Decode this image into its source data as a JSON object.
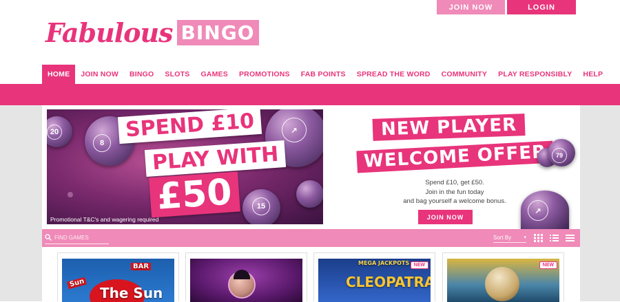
{
  "header": {
    "join_label": "JOIN NOW",
    "login_label": "LOGIN",
    "logo_script": "Fabulous",
    "logo_bingo": "BINGO"
  },
  "nav": {
    "items": [
      {
        "label": "HOME",
        "active": true
      },
      {
        "label": "JOIN NOW"
      },
      {
        "label": "BINGO"
      },
      {
        "label": "SLOTS"
      },
      {
        "label": "GAMES"
      },
      {
        "label": "PROMOTIONS"
      },
      {
        "label": "FAB POINTS"
      },
      {
        "label": "SPREAD THE WORD"
      },
      {
        "label": "COMMUNITY"
      },
      {
        "label": "PLAY RESPONSIBLY"
      },
      {
        "label": "HELP"
      }
    ]
  },
  "hero": {
    "line1": "SPEND £10",
    "line2": "PLAY WITH",
    "line3": "£50",
    "terms": "Promotional T&C's and wagering required",
    "ball_numbers": [
      "20",
      "8",
      "15",
      "79"
    ],
    "offer_title_1": "NEW PLAYER",
    "offer_title_2": "WELCOME OFFER",
    "offer_line1": "Spend £10, get £50.",
    "offer_line2": "Join in the fun today",
    "offer_line3": "and bag yourself a welcome bonus.",
    "offer_button": "JOIN NOW"
  },
  "filters": {
    "search_placeholder": "FIND GAMES",
    "sort_label": "Sort By"
  },
  "games": [
    {
      "title": "The Sun",
      "extra1": "BAR",
      "extra2": "Sun",
      "new": false
    },
    {
      "title": "",
      "new": false
    },
    {
      "title": "MEGA JACKPOTS",
      "subtitle": "CLEOPATRA",
      "new": true,
      "new_label": "NEW"
    },
    {
      "title": "",
      "new": true,
      "new_label": "NEW"
    }
  ],
  "colors": {
    "brand_pink": "#e8347b",
    "light_pink": "#f08ab8"
  }
}
